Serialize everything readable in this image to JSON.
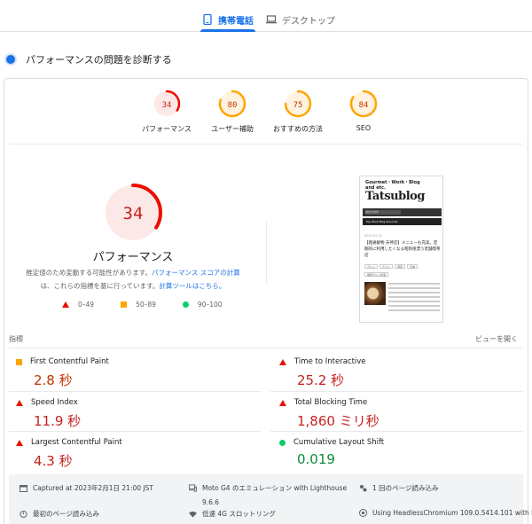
{
  "tabs": {
    "mobile": "携帯電話",
    "desktop": "デスクトップ"
  },
  "section_title": "パフォーマンスの問題を診断する",
  "scores": [
    {
      "value": "34",
      "label": "パフォーマンス",
      "status": "fail",
      "color": "#eb0f00",
      "bg": "#fce8e6"
    },
    {
      "value": "80",
      "label": "ユーザー補助",
      "status": "average",
      "color": "#ffa400",
      "bg": "#fff3e0"
    },
    {
      "value": "75",
      "label": "おすすめの方法",
      "status": "average",
      "color": "#ffa400",
      "bg": "#fff3e0"
    },
    {
      "value": "84",
      "label": "SEO",
      "status": "average",
      "color": "#ffa400",
      "bg": "#fff3e0"
    }
  ],
  "performance": {
    "score": "34",
    "title": "パフォーマンス",
    "desc_prefix": "推定値のため変動する可能性があります。",
    "desc_link1": "パフォーマンス スコアの計算",
    "desc_mid": "は、これらの指標を基に行っています。",
    "desc_link2": "計算ツールはこちら。",
    "legend": [
      "0–49",
      "50–89",
      "90–100"
    ]
  },
  "thumbnail": {
    "blog_small": "Gourmet・Work・Blog",
    "blog_small2": "and etc.",
    "blog_name": "Tatsublog",
    "search_placeholder": "検索を検索",
    "nav": "Top      Work      Blog      Gourmet",
    "date": "2023.01.31",
    "post_title": "【雑通飯物 天神店】メニューも充実。定期的に利用したくなる昭和感漂う老舗喫茶店",
    "tags": [
      "グルメ",
      "カフェ",
      "喫茶",
      "天神"
    ],
    "tag2": "福岡グルメ記事"
  },
  "metrics": {
    "heading": "指標",
    "expand": "ビューを開く",
    "items": [
      {
        "name": "First Contentful Paint",
        "value": "2.8 秒",
        "status": "average"
      },
      {
        "name": "Time to Interactive",
        "value": "25.2 秒",
        "status": "fail"
      },
      {
        "name": "Speed Index",
        "value": "11.9 秒",
        "status": "fail"
      },
      {
        "name": "Total Blocking Time",
        "value": "1,860 ミリ秒",
        "status": "fail"
      },
      {
        "name": "Largest Contentful Paint",
        "value": "4.3 秒",
        "status": "fail"
      },
      {
        "name": "Cumulative Layout Shift",
        "value": "0.019",
        "status": "pass"
      }
    ]
  },
  "runtime": {
    "captured": "Captured at 2023年2月1日 21:00 JST",
    "device_line1": "Moto G4 のエミュレーション with Lighthouse",
    "device_line2": "9.6.6",
    "loads": "1 回のページ読み込み",
    "initial_load": "最初のページ読み込み",
    "throttling": "低速 4G スロットリング",
    "browser": "Using HeadlessChromium 109.0.5414.101 with lr"
  }
}
